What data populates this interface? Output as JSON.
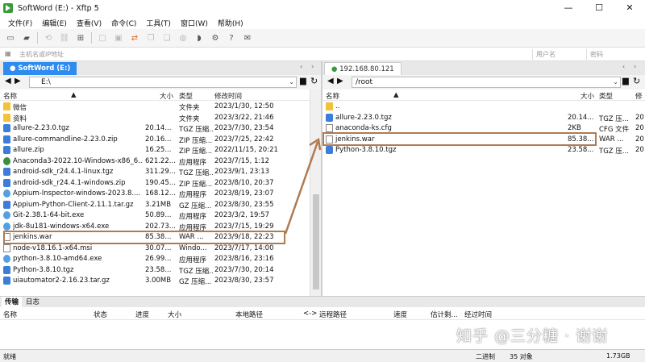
{
  "window": {
    "title": "SoftWord (E:) - Xftp 5",
    "controls": [
      "—",
      "☐",
      "✕"
    ]
  },
  "menu": [
    "文件(F)",
    "编辑(E)",
    "查看(V)",
    "命令(C)",
    "工具(T)",
    "窗口(W)",
    "帮助(H)"
  ],
  "address": {
    "host_placeholder": "主机名或IP地址",
    "user_placeholder": "用户名",
    "pass_placeholder": "密码"
  },
  "left": {
    "tab": "SoftWord (E:)",
    "path": "E:\\",
    "headers": {
      "name": "名称",
      "size": "大小",
      "type": "类型",
      "mtime": "修改时间"
    },
    "rows": [
      {
        "name": "微信",
        "size": "",
        "type": "文件夹",
        "mtime": "2023/1/30, 12:50",
        "icon": "folder"
      },
      {
        "name": "资料",
        "size": "",
        "type": "文件夹",
        "mtime": "2023/3/22, 21:46",
        "icon": "folder"
      },
      {
        "name": "allure-2.23.0.tgz",
        "size": "20.14...",
        "type": "TGZ 压缩...",
        "mtime": "2023/7/30, 23:54",
        "icon": "arch"
      },
      {
        "name": "allure-commandline-2.23.0.zip",
        "size": "20.16...",
        "type": "ZIP 压缩...",
        "mtime": "2023/7/25, 22:42",
        "icon": "arch"
      },
      {
        "name": "allure.zip",
        "size": "16.25...",
        "type": "ZIP 压缩...",
        "mtime": "2022/11/15, 20:21",
        "icon": "arch"
      },
      {
        "name": "Anaconda3-2022.10-Windows-x86_6...",
        "size": "621.22...",
        "type": "应用程序",
        "mtime": "2023/7/15, 1:12",
        "icon": "app"
      },
      {
        "name": "android-sdk_r24.4.1-linux.tgz",
        "size": "311.29...",
        "type": "TGZ 压缩...",
        "mtime": "2023/9/1, 23:13",
        "icon": "arch"
      },
      {
        "name": "android-sdk_r24.4.1-windows.zip",
        "size": "190.45...",
        "type": "ZIP 压缩...",
        "mtime": "2023/8/10, 20:37",
        "icon": "arch"
      },
      {
        "name": "Appium-Inspector-windows-2023.8....",
        "size": "168.12...",
        "type": "应用程序",
        "mtime": "2023/8/19, 23:07",
        "icon": "exe"
      },
      {
        "name": "Appium-Python-Client-2.11.1.tar.gz",
        "size": "3.21MB",
        "type": "GZ 压缩...",
        "mtime": "2023/8/30, 23:55",
        "icon": "arch"
      },
      {
        "name": "Git-2.38.1-64-bit.exe",
        "size": "50.89...",
        "type": "应用程序",
        "mtime": "2023/3/2, 19:57",
        "icon": "exe"
      },
      {
        "name": "jdk-8u181-windows-x64.exe",
        "size": "202.73...",
        "type": "应用程序",
        "mtime": "2023/7/15, 19:29",
        "icon": "exe"
      },
      {
        "name": "jenkins.war",
        "size": "85.38...",
        "type": "WAR ...",
        "mtime": "2023/9/18, 22:23",
        "icon": "file"
      },
      {
        "name": "node-v18.16.1-x64.msi",
        "size": "30.07...",
        "type": "Windo...",
        "mtime": "2023/7/17, 14:00",
        "icon": "file"
      },
      {
        "name": "python-3.8.10-amd64.exe",
        "size": "26.99...",
        "type": "应用程序",
        "mtime": "2023/8/16, 23:16",
        "icon": "exe"
      },
      {
        "name": "Python-3.8.10.tgz",
        "size": "23.58...",
        "type": "TGZ 压缩...",
        "mtime": "2023/7/30, 20:14",
        "icon": "arch"
      },
      {
        "name": "uiautomator2-2.16.23.tar.gz",
        "size": "3.00MB",
        "type": "GZ 压缩...",
        "mtime": "2023/8/30, 23:57",
        "icon": "arch"
      }
    ]
  },
  "right": {
    "tab": "192.168.80.121",
    "path": "/root",
    "headers": {
      "name": "名称",
      "size": "大小",
      "type": "类型",
      "mtime": "修"
    },
    "rows": [
      {
        "name": "..",
        "size": "",
        "type": "",
        "mtime": "",
        "icon": "folder"
      },
      {
        "name": "allure-2.23.0.tgz",
        "size": "20.14...",
        "type": "TGZ 压...",
        "mtime": "20",
        "icon": "arch"
      },
      {
        "name": "anaconda-ks.cfg",
        "size": "2KB",
        "type": "CFG 文件",
        "mtime": "20",
        "icon": "file"
      },
      {
        "name": "jenkins.war",
        "size": "85.38...",
        "type": "WAR ...",
        "mtime": "20",
        "icon": "file"
      },
      {
        "name": "Python-3.8.10.tgz",
        "size": "23.58...",
        "type": "TGZ 压...",
        "mtime": "20",
        "icon": "arch"
      }
    ]
  },
  "transfer": {
    "tabs": [
      "传输",
      "日志"
    ],
    "headers": [
      "名称",
      "状态",
      "进度",
      "大小",
      "本地路径",
      "<->",
      "远程路径",
      "速度",
      "估计剩...",
      "经过时间"
    ]
  },
  "status": {
    "left": "就绪",
    "mode": "二进制",
    "count": "35 对象",
    "size": "1.73GB"
  },
  "watermark": "知乎 @三分糖 · 谢谢"
}
